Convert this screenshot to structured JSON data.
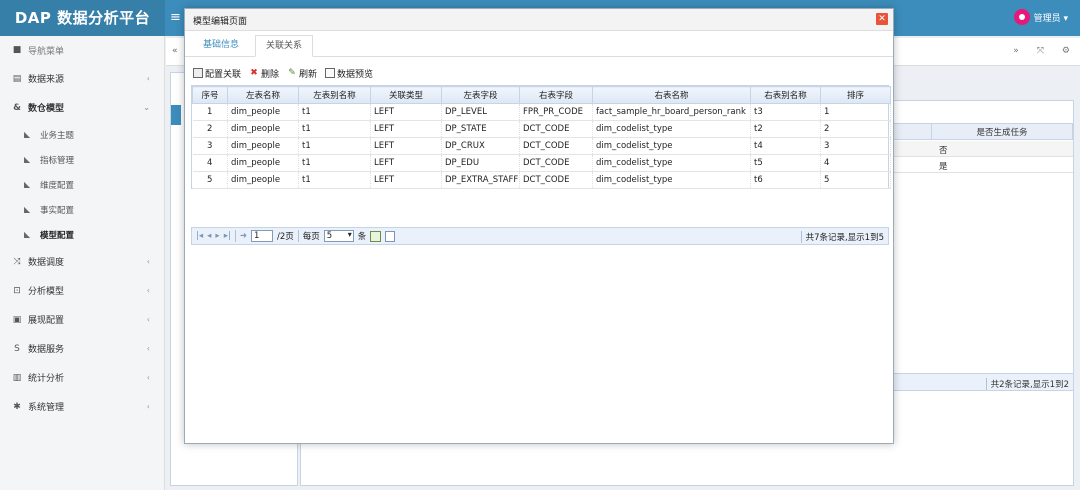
{
  "app": {
    "logo": "DAP 数据分析平台",
    "user_name": "管理员 ▾"
  },
  "sidebar": {
    "header": "导航菜单",
    "items": [
      {
        "label": "数据来源"
      },
      {
        "label": "数仓模型"
      },
      {
        "label": "数据调度"
      },
      {
        "label": "分析模型"
      },
      {
        "label": "展现配置"
      },
      {
        "label": "数据服务"
      },
      {
        "label": "统计分析"
      },
      {
        "label": "系统管理"
      }
    ],
    "subitems": [
      {
        "label": "业务主题"
      },
      {
        "label": "指标管理"
      },
      {
        "label": "维度配置"
      },
      {
        "label": "事实配置"
      },
      {
        "label": "模型配置"
      }
    ]
  },
  "background": {
    "grid_header": "是否生成任务",
    "rows": [
      "否",
      "是"
    ],
    "footer": "共2条记录,显示1到2"
  },
  "modal": {
    "title": "模型编辑页面",
    "close": "✕",
    "tabs": [
      "基础信息",
      "关联关系"
    ],
    "toolbar": {
      "config": "配置关联",
      "delete": "删除",
      "refresh": "刷新",
      "preview": "数据预览"
    },
    "columns": [
      "序号",
      "左表名称",
      "左表别名称",
      "关联类型",
      "左表字段",
      "右表字段",
      "右表名称",
      "右表别名称",
      "排序"
    ],
    "rows": [
      [
        "1",
        "dim_people",
        "t1",
        "LEFT",
        "DP_LEVEL",
        "FPR_PR_CODE",
        "fact_sample_hr_board_person_rank",
        "t3",
        "1"
      ],
      [
        "2",
        "dim_people",
        "t1",
        "LEFT",
        "DP_STATE",
        "DCT_CODE",
        "dim_codelist_type",
        "t2",
        "2"
      ],
      [
        "3",
        "dim_people",
        "t1",
        "LEFT",
        "DP_CRUX",
        "DCT_CODE",
        "dim_codelist_type",
        "t4",
        "3"
      ],
      [
        "4",
        "dim_people",
        "t1",
        "LEFT",
        "DP_EDU",
        "DCT_CODE",
        "dim_codelist_type",
        "t5",
        "4"
      ],
      [
        "5",
        "dim_people",
        "t1",
        "LEFT",
        "DP_EXTRA_STAFF",
        "DCT_CODE",
        "dim_codelist_type",
        "t6",
        "5"
      ]
    ],
    "pager": {
      "page_value": "1",
      "total_pages": "/2页",
      "per_page_label": "每页",
      "per_page_value": "5",
      "per_page_unit": "条",
      "summary": "共7条记录,显示1到5"
    }
  }
}
